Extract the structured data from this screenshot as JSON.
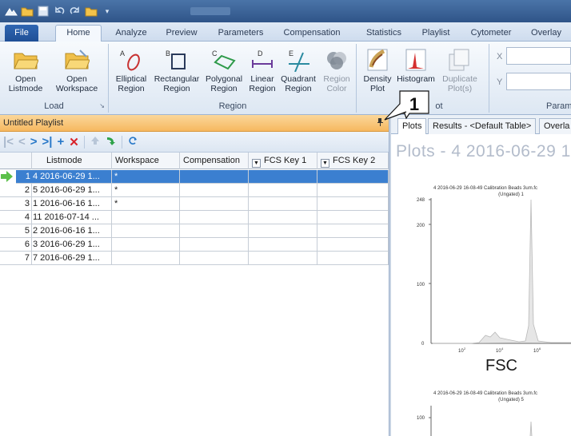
{
  "ribbon_tabs": [
    "File",
    "Home",
    "Analyze",
    "Preview",
    "Parameters",
    "Compensation",
    "Statistics",
    "Playlist",
    "Cytometer",
    "Overlay"
  ],
  "groups": {
    "load": {
      "label": "Load",
      "buttons": [
        {
          "label": "Open\nListmode"
        },
        {
          "label": "Open\nWorkspace"
        }
      ]
    },
    "region": {
      "label": "Region",
      "buttons": [
        {
          "label": "Elliptical\nRegion",
          "letter": "A"
        },
        {
          "label": "Rectangular\nRegion",
          "letter": "B"
        },
        {
          "label": "Polygonal\nRegion",
          "letter": "C"
        },
        {
          "label": "Linear\nRegion",
          "letter": "D"
        },
        {
          "label": "Quadrant\nRegion",
          "letter": "E"
        },
        {
          "label": "Region\nColor"
        }
      ]
    },
    "plot": {
      "label_visible": "ot",
      "buttons": [
        {
          "label": "Density\nPlot"
        },
        {
          "label": "Histogram"
        },
        {
          "label": "Duplicate\nPlot(s)"
        }
      ]
    },
    "params": {
      "label_visible": "Param",
      "x_label": "X",
      "y_label": "Y"
    }
  },
  "callout": {
    "number": "1"
  },
  "playlist": {
    "title": "Untitled Playlist",
    "columns": [
      "Listmode",
      "Workspace",
      "Compensation",
      "FCS Key 1",
      "FCS Key 2"
    ],
    "rows": [
      {
        "idx": "1",
        "listmode": "4 2016-06-29 1...",
        "workspace": "*",
        "selected": true
      },
      {
        "idx": "2",
        "listmode": "5 2016-06-29 1...",
        "workspace": "*"
      },
      {
        "idx": "3",
        "listmode": "1 2016-06-16 1...",
        "workspace": "*"
      },
      {
        "idx": "4",
        "listmode": "11 2016-07-14 ...",
        "workspace": ""
      },
      {
        "idx": "5",
        "listmode": "2 2016-06-16 1...",
        "workspace": ""
      },
      {
        "idx": "6",
        "listmode": "3 2016-06-29 1...",
        "workspace": ""
      },
      {
        "idx": "7",
        "listmode": "7 2016-06-29 1...",
        "workspace": ""
      }
    ]
  },
  "right_tabs": [
    "Plots",
    "Results - <Default Table>",
    "Overla"
  ],
  "plots_title": "Plots - 4 2016-06-29 1",
  "plot1": {
    "title": "4 2016-06-29 16-08-49 Calibration Beads 3um.fc",
    "subtitle": "(Ungated) 1",
    "y_ticks": [
      "248",
      "200",
      "100",
      "0"
    ],
    "x_ticks": [
      "10",
      "10",
      "10"
    ],
    "xlabel": "FSC"
  },
  "plot2": {
    "title": "4 2016-06-29 16-08-49 Calibration Beads 3um.fc",
    "subtitle": "(Ungated) 5",
    "y_ticks": [
      "100"
    ]
  }
}
